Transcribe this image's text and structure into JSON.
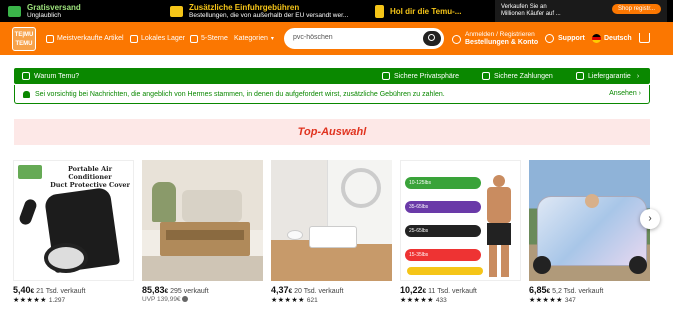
{
  "promo": {
    "item1_title": "Gratisversand",
    "item1_sub": "Unglaublich",
    "item2_title": "Zusätzliche Einfuhrgebühren",
    "item2_sub": "Bestellungen, die von außerhalb der EU versandt wer...",
    "item3_title": "Hol dir die Temu-...",
    "item4_text1": "Verkaufen Sie an",
    "item4_text2": "Millionen Käufer auf ...",
    "item4_button": "Shop registr..."
  },
  "header": {
    "logo_text_1": "TE|MU",
    "logo_text_2": "TEMU",
    "nav": [
      "Meistverkaufte Artikel",
      "Lokales Lager",
      "5-Sterne",
      "Kategorien"
    ],
    "search_value": "pvc-höschen",
    "account_line1": "Anmelden / Registrieren",
    "account_line2": "Bestellungen & Konto",
    "support": "Support",
    "language": "Deutsch"
  },
  "trust": {
    "why": "Warum Temu?",
    "privacy": "Sichere Privatsphäre",
    "payments": "Sichere Zahlungen",
    "delivery": "Liefergarantie",
    "notice": "Sei vorsichtig bei Nachrichten, die angeblich von Hermes stammen, in denen du aufgefordert wirst, zusätzliche Gebühren zu zahlen.",
    "notice_more": "Ansehen"
  },
  "section_title": "Top-Auswahl",
  "products": [
    {
      "img_title_1": "Portable Air Conditioner",
      "img_title_2": "Duct Protective Cover",
      "price_main": "5,40",
      "price_cur": "€",
      "sold": "21 Tsd. verkauft",
      "uvp": "",
      "stars": "★★★★★",
      "reviews": "1.297"
    },
    {
      "price_main": "85,83",
      "price_cur": "€",
      "sold": "295 verkauft",
      "uvp": "UVP 139,99€",
      "stars": "★★★★★",
      "reviews": ""
    },
    {
      "price_main": "4,37",
      "price_cur": "€",
      "sold": "20 Tsd. verkauft",
      "uvp": "",
      "stars": "★★★★★",
      "reviews": "621"
    },
    {
      "price_main": "10,22",
      "price_cur": "€",
      "sold": "11 Tsd. verkauft",
      "uvp": "",
      "stars": "★★★★★",
      "reviews": "433",
      "band_labels": [
        "10-125lbs",
        "35-65lbs",
        "25-65lbs",
        "15-35lbs"
      ]
    },
    {
      "price_main": "6,85",
      "price_cur": "€",
      "sold": "5,2 Tsd. verkauft",
      "uvp": "",
      "stars": "★★★★★",
      "reviews": "347"
    }
  ],
  "carousel_next": "›"
}
